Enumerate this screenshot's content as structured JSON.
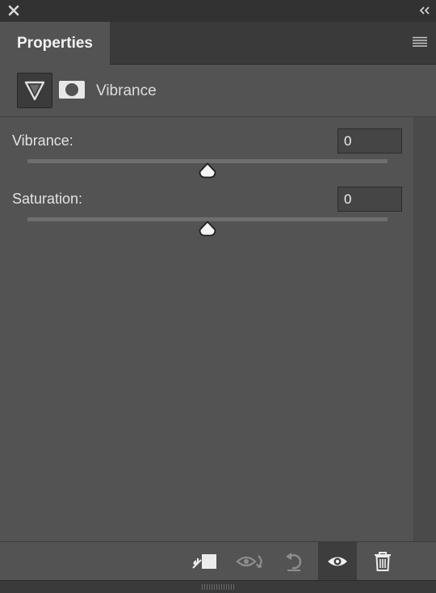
{
  "panel": {
    "tab_label": "Properties"
  },
  "adjustment": {
    "title": "Vibrance",
    "icons": {
      "adjustment": "vibrance-triangle-icon",
      "mask": "layer-mask-icon"
    }
  },
  "controls": [
    {
      "label": "Vibrance:",
      "value": "0",
      "slider_position": 0.5
    },
    {
      "label": "Saturation:",
      "value": "0",
      "slider_position": 0.5
    }
  ],
  "bottom_toolbar": [
    {
      "name": "clip-to-layer-icon"
    },
    {
      "name": "view-previous-state-icon"
    },
    {
      "name": "reset-adjustment-icon"
    },
    {
      "name": "toggle-visibility-icon",
      "active": true
    },
    {
      "name": "delete-icon"
    }
  ],
  "colors": {
    "panel_bg": "#535353",
    "header_bg": "#323232",
    "text": "#e6e6e6"
  }
}
